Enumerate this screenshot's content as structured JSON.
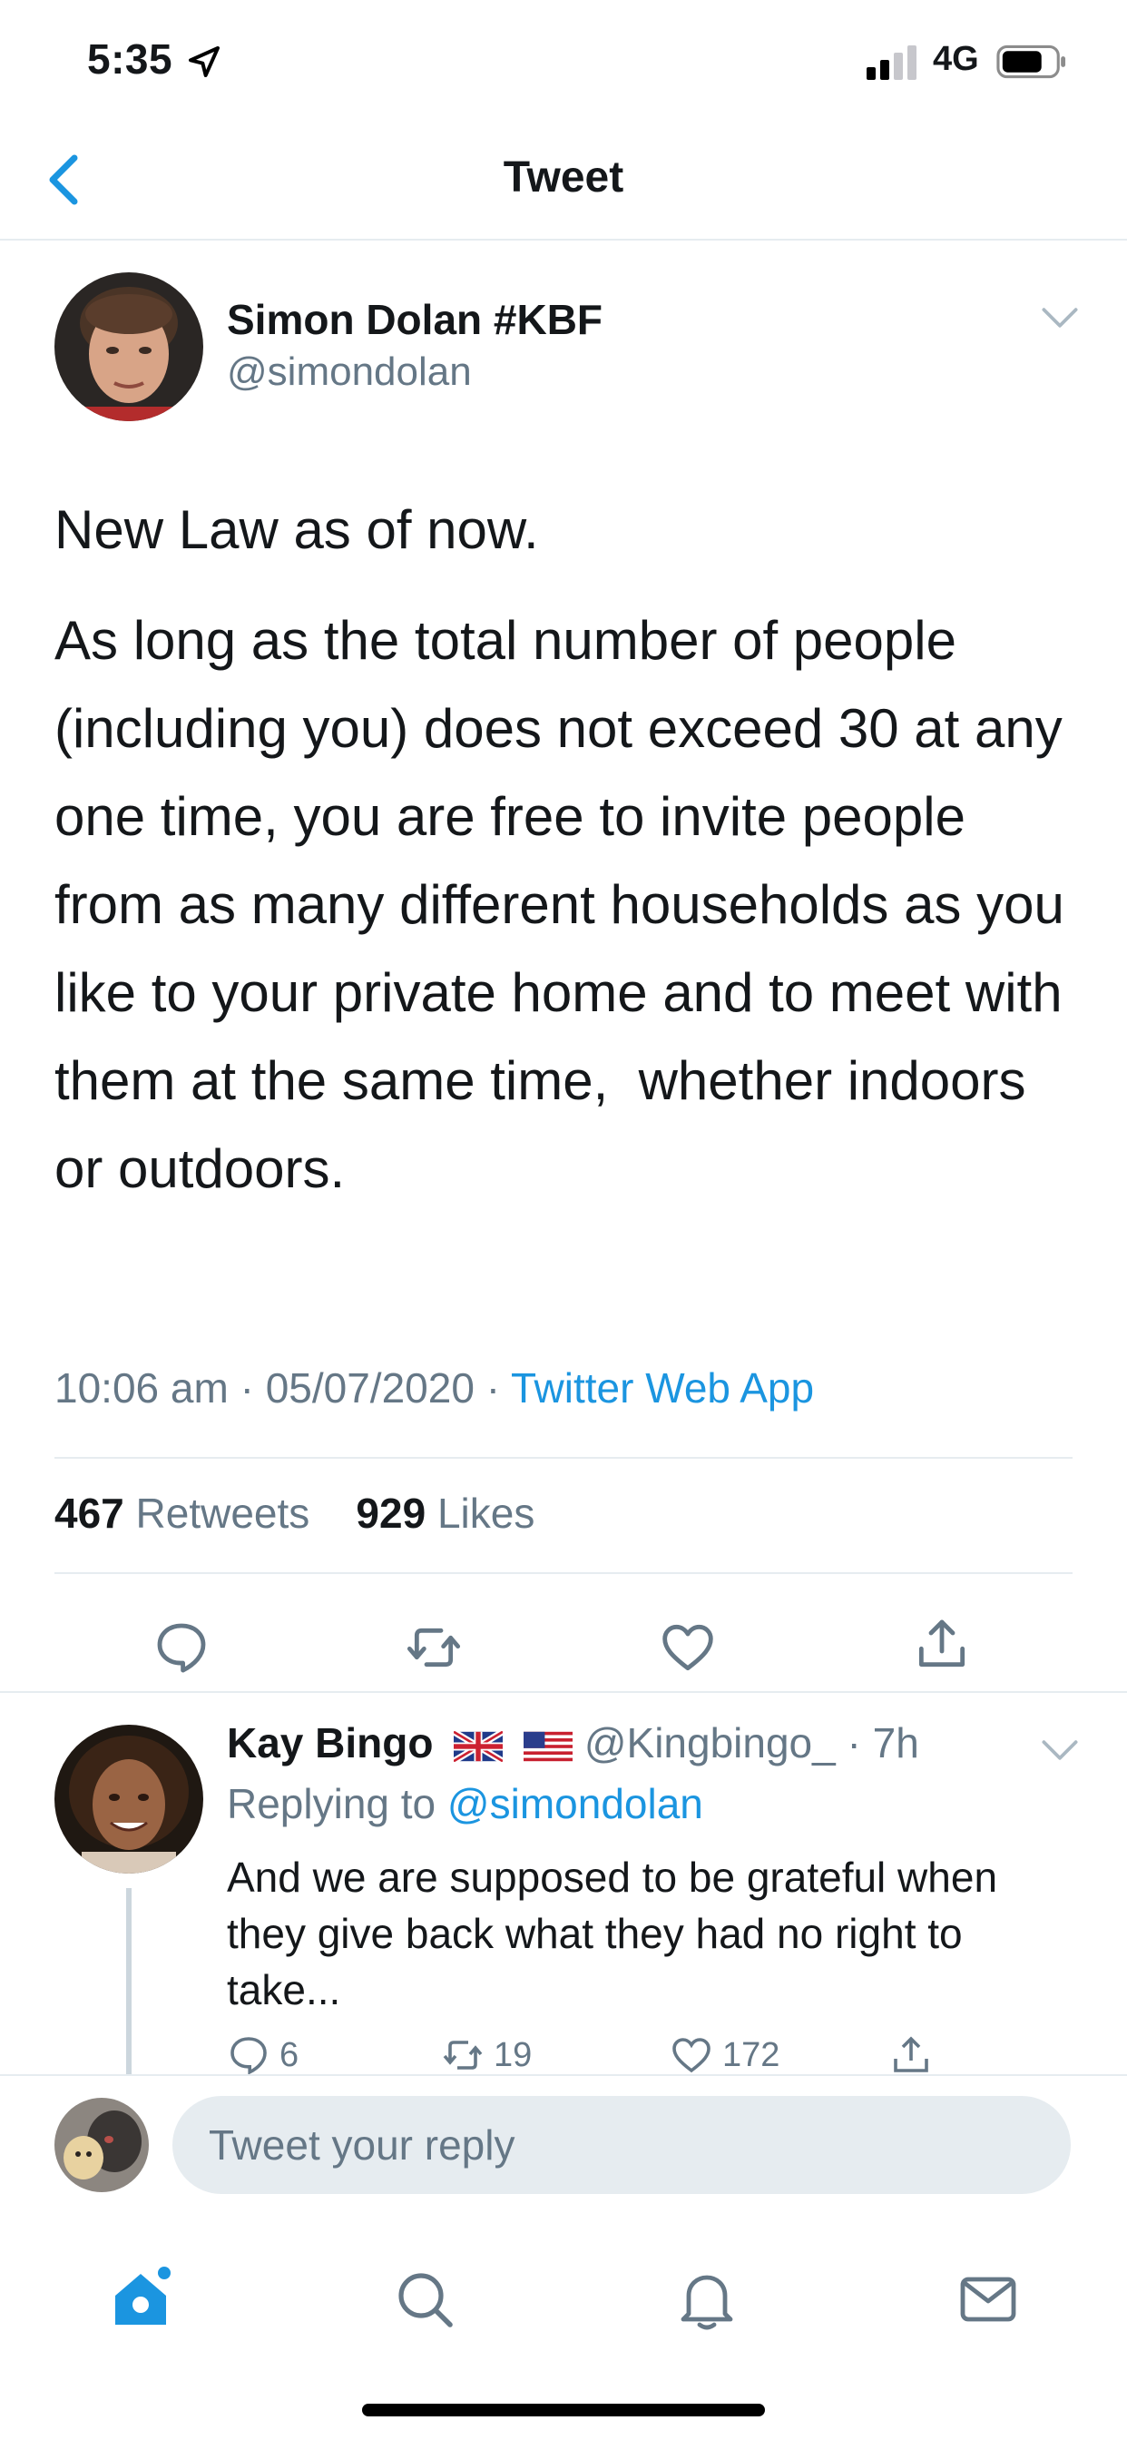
{
  "status_bar": {
    "time": "5:35",
    "network": "4G"
  },
  "nav": {
    "title": "Tweet"
  },
  "tweet": {
    "author_name": "Simon Dolan #KBF",
    "author_handle": "@simondolan",
    "paragraphs": [
      "New Law as of now.",
      "As long as the total number of people (including you) does not exceed 30 at any one time, you are free to invite people from as many different households as you like to your private home and to meet with them at the same time,  whether indoors or outdoors."
    ],
    "time": "10:06 am",
    "date": "05/07/2020",
    "source": "Twitter Web App",
    "retweets_count": "467",
    "retweets_label": "Retweets",
    "likes_count": "929",
    "likes_label": "Likes"
  },
  "reply": {
    "author_name": "Kay Bingo",
    "flags": [
      "uk-flag-icon",
      "us-flag-icon"
    ],
    "author_handle": "@Kingbingo_",
    "time": "7h",
    "replying_prefix": "Replying to",
    "replying_to": "@simondolan",
    "text": "And we are supposed to be grateful when they give back what they had no right to take...",
    "reply_count": "6",
    "retweet_count": "19",
    "like_count": "172"
  },
  "composer": {
    "placeholder": "Tweet your reply"
  },
  "tab_bar": {
    "items": [
      "home-icon",
      "search-icon",
      "notifications-icon",
      "messages-icon"
    ]
  },
  "colors": {
    "accent": "#1b95e0",
    "secondary_text": "#657786",
    "divider": "#e6ecf0"
  }
}
